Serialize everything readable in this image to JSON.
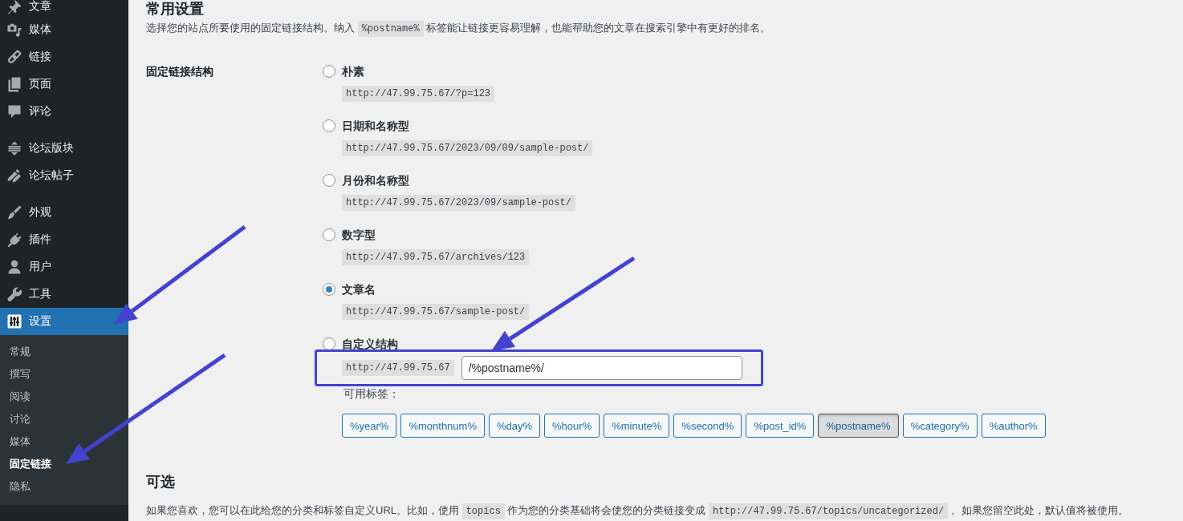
{
  "sidebar": {
    "groups": [
      {
        "items": [
          {
            "label": "文章",
            "selected": false
          },
          {
            "label": "媒体",
            "selected": false
          },
          {
            "label": "链接",
            "selected": false
          },
          {
            "label": "页面",
            "selected": false
          },
          {
            "label": "评论",
            "selected": false
          }
        ]
      },
      {
        "items": [
          {
            "label": "论坛版块",
            "selected": false
          },
          {
            "label": "论坛帖子",
            "selected": false
          }
        ]
      },
      {
        "items": [
          {
            "label": "外观",
            "selected": false
          },
          {
            "label": "插件",
            "selected": false
          },
          {
            "label": "用户",
            "selected": false
          },
          {
            "label": "工具",
            "selected": false
          },
          {
            "label": "设置",
            "selected": true,
            "children": [
              {
                "label": "常规",
                "selected": false
              },
              {
                "label": "撰写",
                "selected": false
              },
              {
                "label": "阅读",
                "selected": false
              },
              {
                "label": "讨论",
                "selected": false
              },
              {
                "label": "媒体",
                "selected": false
              },
              {
                "label": "固定链接",
                "selected": true
              },
              {
                "label": "隐私",
                "selected": false
              }
            ]
          }
        ]
      }
    ]
  },
  "content": {
    "heading": "常用设置",
    "description": [
      {
        "kind": "text",
        "text": "选择您的站点所要使用的固定链接结构。纳入 "
      },
      {
        "kind": "code",
        "text": "%postname%"
      },
      {
        "kind": "text",
        "text": " 标签能让链接更容易理解，也能帮助您的文章在搜索引擎中有更好的排名。"
      }
    ],
    "permalink": {
      "label": "固定链接结构",
      "options": [
        {
          "kind": "preset",
          "label": "朴素",
          "example": "http://47.99.75.67/?p=123",
          "selected": false
        },
        {
          "kind": "preset",
          "label": "日期和名称型",
          "example": "http://47.99.75.67/2023/09/09/sample-post/",
          "selected": false
        },
        {
          "kind": "preset",
          "label": "月份和名称型",
          "example": "http://47.99.75.67/2023/09/sample-post/",
          "selected": false
        },
        {
          "kind": "preset",
          "label": "数字型",
          "example": "http://47.99.75.67/archives/123",
          "selected": false
        },
        {
          "kind": "preset",
          "label": "文章名",
          "example": "http://47.99.75.67/sample-post/",
          "selected": true
        },
        {
          "kind": "custom",
          "label": "自定义结构",
          "selected": false,
          "prefix": "http://47.99.75.67",
          "value": "/%postname%/",
          "tags_label": "可用标签：",
          "tags": [
            {
              "label": "%year%",
              "selected": false
            },
            {
              "label": "%monthnum%",
              "selected": false
            },
            {
              "label": "%day%",
              "selected": false
            },
            {
              "label": "%hour%",
              "selected": false
            },
            {
              "label": "%minute%",
              "selected": false
            },
            {
              "label": "%second%",
              "selected": false
            },
            {
              "label": "%post_id%",
              "selected": false
            },
            {
              "label": "%postname%",
              "selected": true
            },
            {
              "label": "%category%",
              "selected": false
            },
            {
              "label": "%author%",
              "selected": false
            }
          ]
        }
      ]
    },
    "optional": {
      "heading": "可选",
      "description": [
        {
          "kind": "text",
          "text": "如果您喜欢，您可以在此给您的分类和标签自定义URL。比如，使用 "
        },
        {
          "kind": "code",
          "text": "topics"
        },
        {
          "kind": "text",
          "text": " 作为您的分类基础将会使您的分类链接变成 "
        },
        {
          "kind": "code",
          "text": "http://47.99.75.67/topics/uncategorized/"
        },
        {
          "kind": "text",
          "text": " 。如果您留空此处，默认值将被使用。"
        }
      ]
    }
  }
}
